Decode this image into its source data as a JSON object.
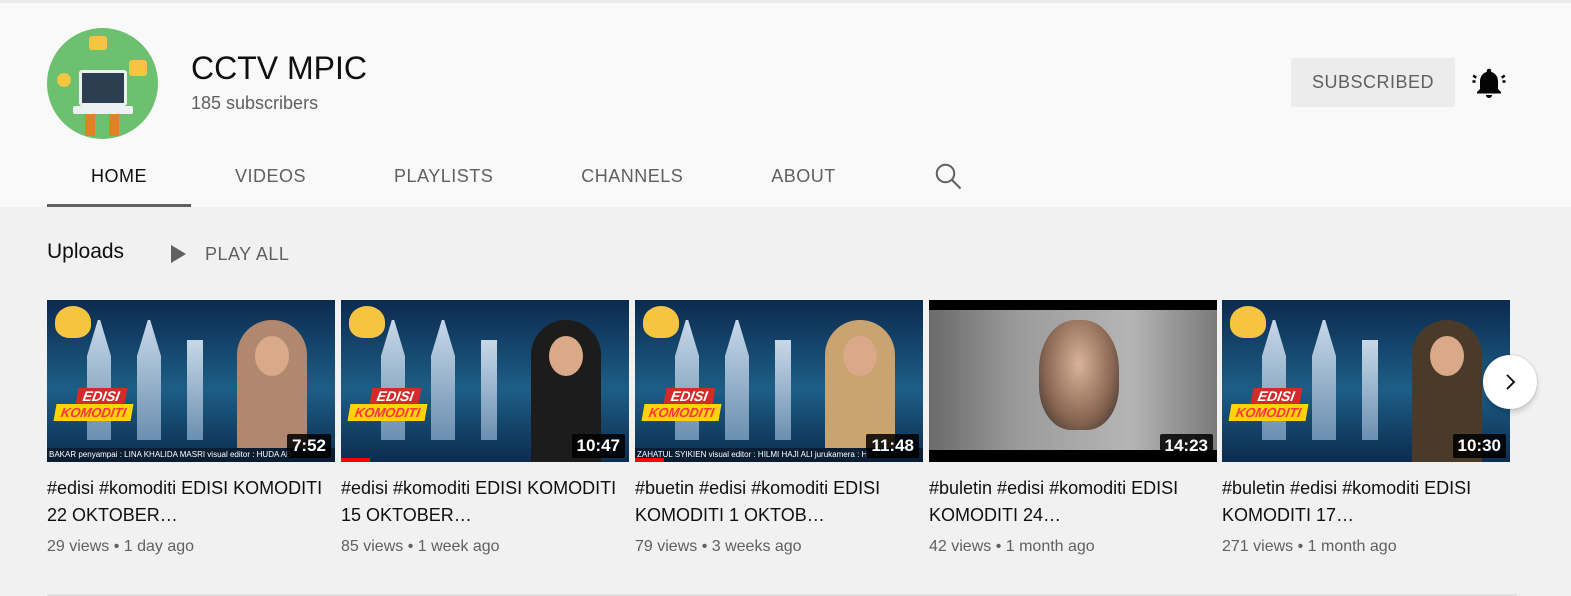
{
  "channel": {
    "name": "CCTV MPIC",
    "subscribers": "185 subscribers",
    "subscribe_label": "SUBSCRIBED"
  },
  "tabs": [
    {
      "label": "HOME",
      "active": true
    },
    {
      "label": "VIDEOS",
      "active": false
    },
    {
      "label": "PLAYLISTS",
      "active": false
    },
    {
      "label": "CHANNELS",
      "active": false
    },
    {
      "label": "ABOUT",
      "active": false
    }
  ],
  "shelf": {
    "title": "Uploads",
    "play_all_label": "PLAY ALL"
  },
  "videos": [
    {
      "title": "#edisi #komoditi EDISI KOMODITI 22 OKTOBER…",
      "meta": "29 views • 1 day ago",
      "duration": "7:52",
      "thumb_text": "EDISI",
      "thumb_text2": "KOMODITI",
      "ticker": "BAKAR   penyampai : LINA KHALIDA MASRI   visual editor : HUDA AB"
    },
    {
      "title": "#edisi #komoditi EDISI KOMODITI 15 OKTOBER…",
      "meta": "85 views • 1 week ago",
      "duration": "10:47",
      "thumb_text": "EDISI",
      "thumb_text2": "KOMODITI",
      "ticker": ""
    },
    {
      "title": "#buetin #edisi #komoditi EDISI KOMODITI 1 OKTOB…",
      "meta": "79 views • 3 weeks ago",
      "duration": "11:48",
      "thumb_text": "EDISI",
      "thumb_text2": "KOMODITI",
      "ticker": "ZAHATUL SYIKIEN   visual editor : HILMI HAJI ALI   jurukamera : H"
    },
    {
      "title": "#buletin #edisi #komoditi EDISI KOMODITI 24…",
      "meta": "42 views • 1 month ago",
      "duration": "14:23"
    },
    {
      "title": "#buletin #edisi #komoditi EDISI KOMODITI 17…",
      "meta": "271 views • 1 month ago",
      "duration": "10:30",
      "thumb_text": "EDISI",
      "thumb_text2": "KOMODITI"
    }
  ],
  "colors": {
    "accent_red": "#ff0000",
    "text_primary": "#0f0f0f",
    "text_secondary": "#606060"
  },
  "icons": {
    "bell": "bell-icon",
    "search": "search-icon",
    "play": "play-icon",
    "next": "chevron-right-icon"
  }
}
